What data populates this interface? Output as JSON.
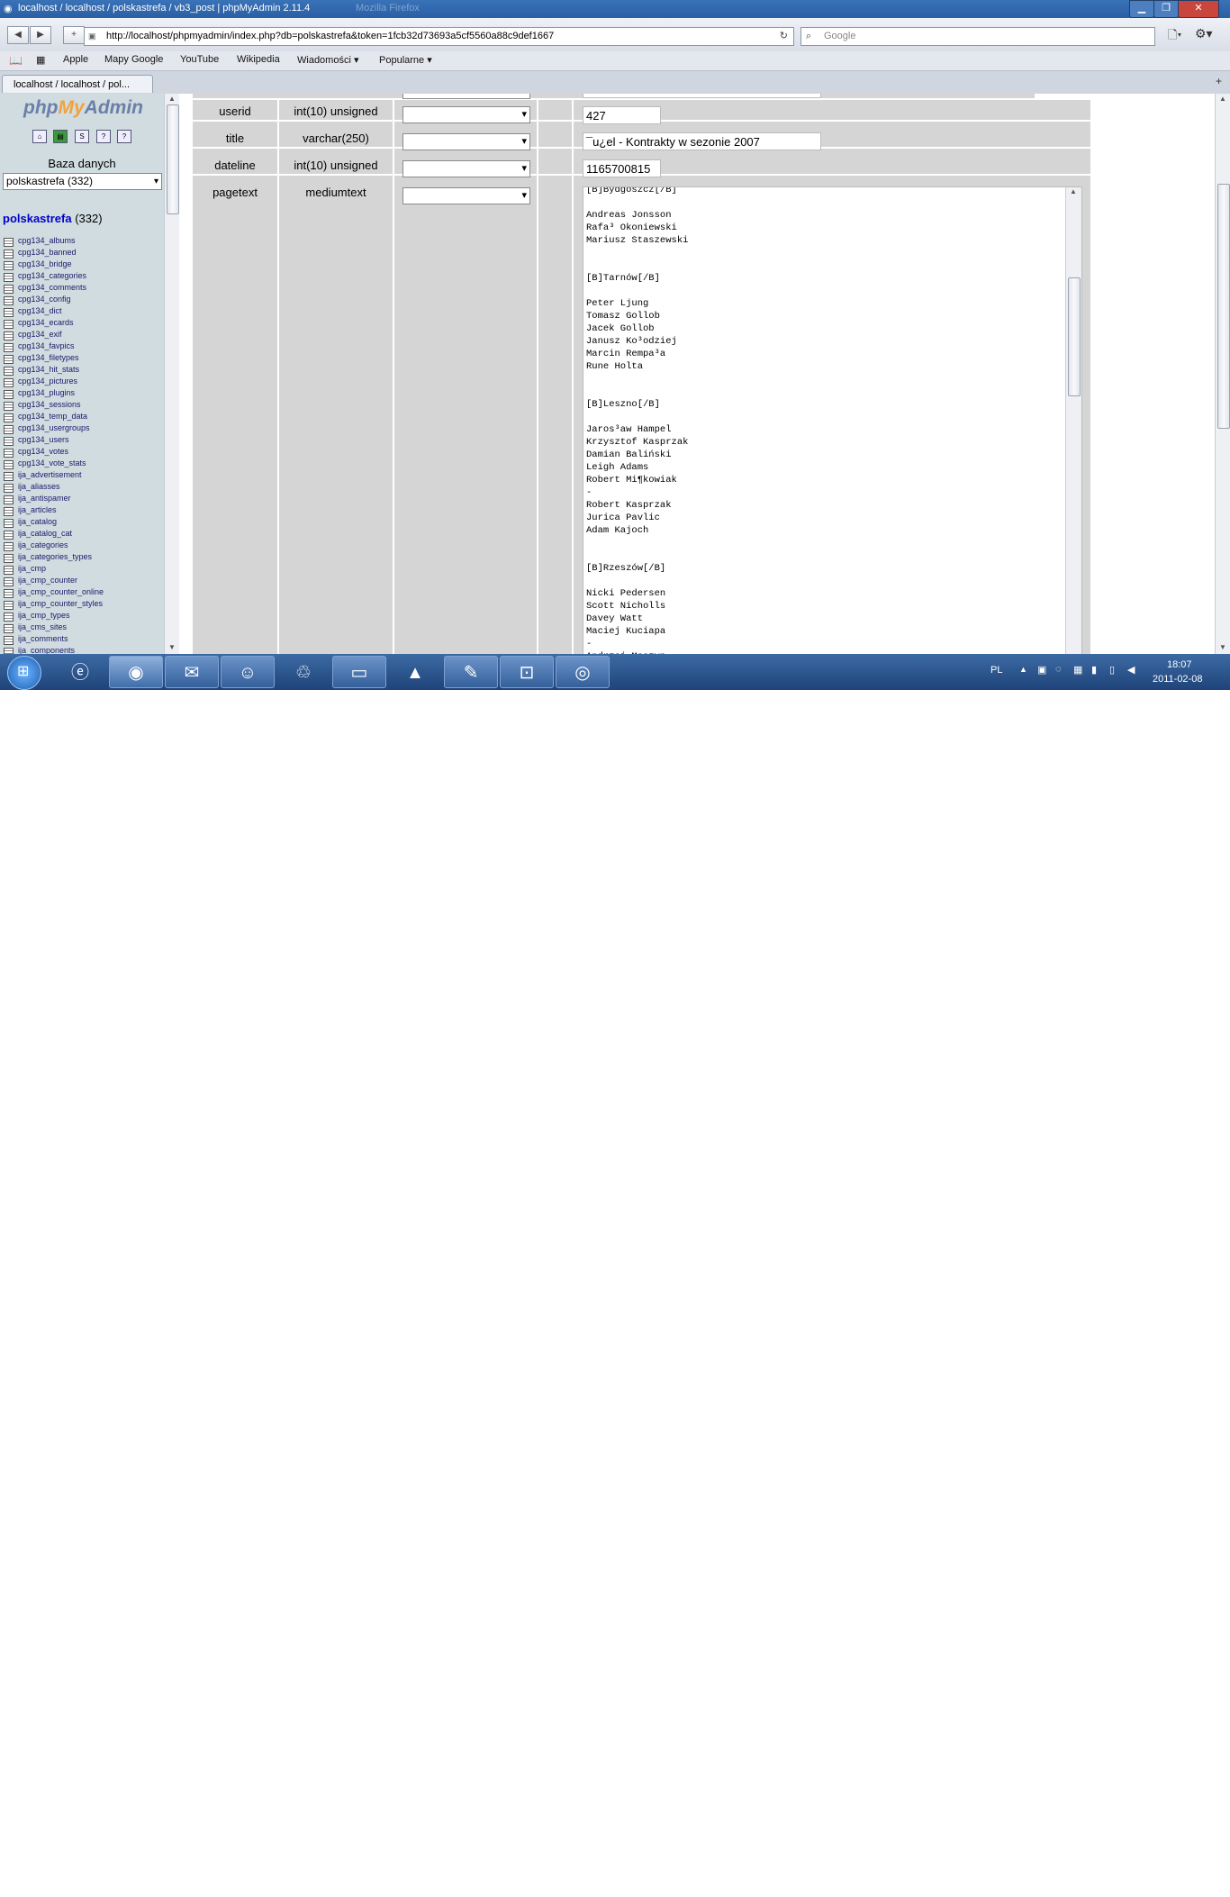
{
  "window": {
    "title": "localhost / localhost / polskastrefa / vb3_post | phpMyAdmin 2.11.4",
    "faint_title": "Mozilla Firefox"
  },
  "toolbar": {
    "url": "http://localhost/phpmyadmin/index.php?db=polskastrefa&token=1fcb32d73693a5cf5560a88c9def1667",
    "search_placeholder": "Google"
  },
  "bookmarks": [
    "Apple",
    "Mapy Google",
    "YouTube",
    "Wikipedia",
    "Wiadomości ▾",
    "Popularne ▾"
  ],
  "tab": {
    "label": "localhost / localhost / pol..."
  },
  "sidebar": {
    "logo_php": "php",
    "logo_my": "My",
    "logo_admin": "Admin",
    "db_label": "Baza danych",
    "db_select": "polskastrefa (332)",
    "db_name": "polskastrefa",
    "db_count": "(332)",
    "tables": [
      "cpg134_albums",
      "cpg134_banned",
      "cpg134_bridge",
      "cpg134_categories",
      "cpg134_comments",
      "cpg134_config",
      "cpg134_dict",
      "cpg134_ecards",
      "cpg134_exif",
      "cpg134_favpics",
      "cpg134_filetypes",
      "cpg134_hit_stats",
      "cpg134_pictures",
      "cpg134_plugins",
      "cpg134_sessions",
      "cpg134_temp_data",
      "cpg134_usergroups",
      "cpg134_users",
      "cpg134_votes",
      "cpg134_vote_stats",
      "ija_advertisement",
      "ija_aliasses",
      "ija_antispamer",
      "ija_articles",
      "ija_catalog",
      "ija_catalog_cat",
      "ija_categories",
      "ija_categories_types",
      "ija_cmp",
      "ija_cmp_counter",
      "ija_cmp_counter_online",
      "ija_cmp_counter_styles",
      "ija_cmp_types",
      "ija_cms_sites",
      "ija_comments",
      "ija_components"
    ]
  },
  "rows": [
    {
      "field": "userid",
      "type": "int(10) unsigned",
      "value": "427"
    },
    {
      "field": "title",
      "type": "varchar(250)",
      "value": "¯u¿el - Kontrakty w sezonie 2007"
    },
    {
      "field": "dateline",
      "type": "int(10) unsigned",
      "value": "1165700815"
    },
    {
      "field": "pagetext",
      "type": "mediumtext",
      "value": ""
    }
  ],
  "pagetext": "[B]Bydgoszcz[/B]\n\nAndreas Jonsson\nRafa³ Okoniewski\nMariusz Staszewski\n\n\n[B]Tarnów[/B]\n\nPeter Ljung\nTomasz Gollob\nJacek Gollob\nJanusz Ko³odziej\nMarcin Rempa³a\nRune Holta\n\n\n[B]Leszno[/B]\n\nJaros³aw Hampel\nKrzysztof Kasprzak\nDamian Baliński\nLeigh Adams\nRobert Mi¶kowiak\n-\nRobert Kasprzak\nJurica Pavlic\nAdam Kajoch\n\n\n[B]Rzeszów[/B]\n\nNicki Pedersen\nScott Nicholls\nDavey Watt\nMaciej Kuciapa\n-\nAndrzej Moszyn",
  "taskbar": {
    "language": "PL",
    "time": "18:07",
    "date": "2011-02-08"
  }
}
